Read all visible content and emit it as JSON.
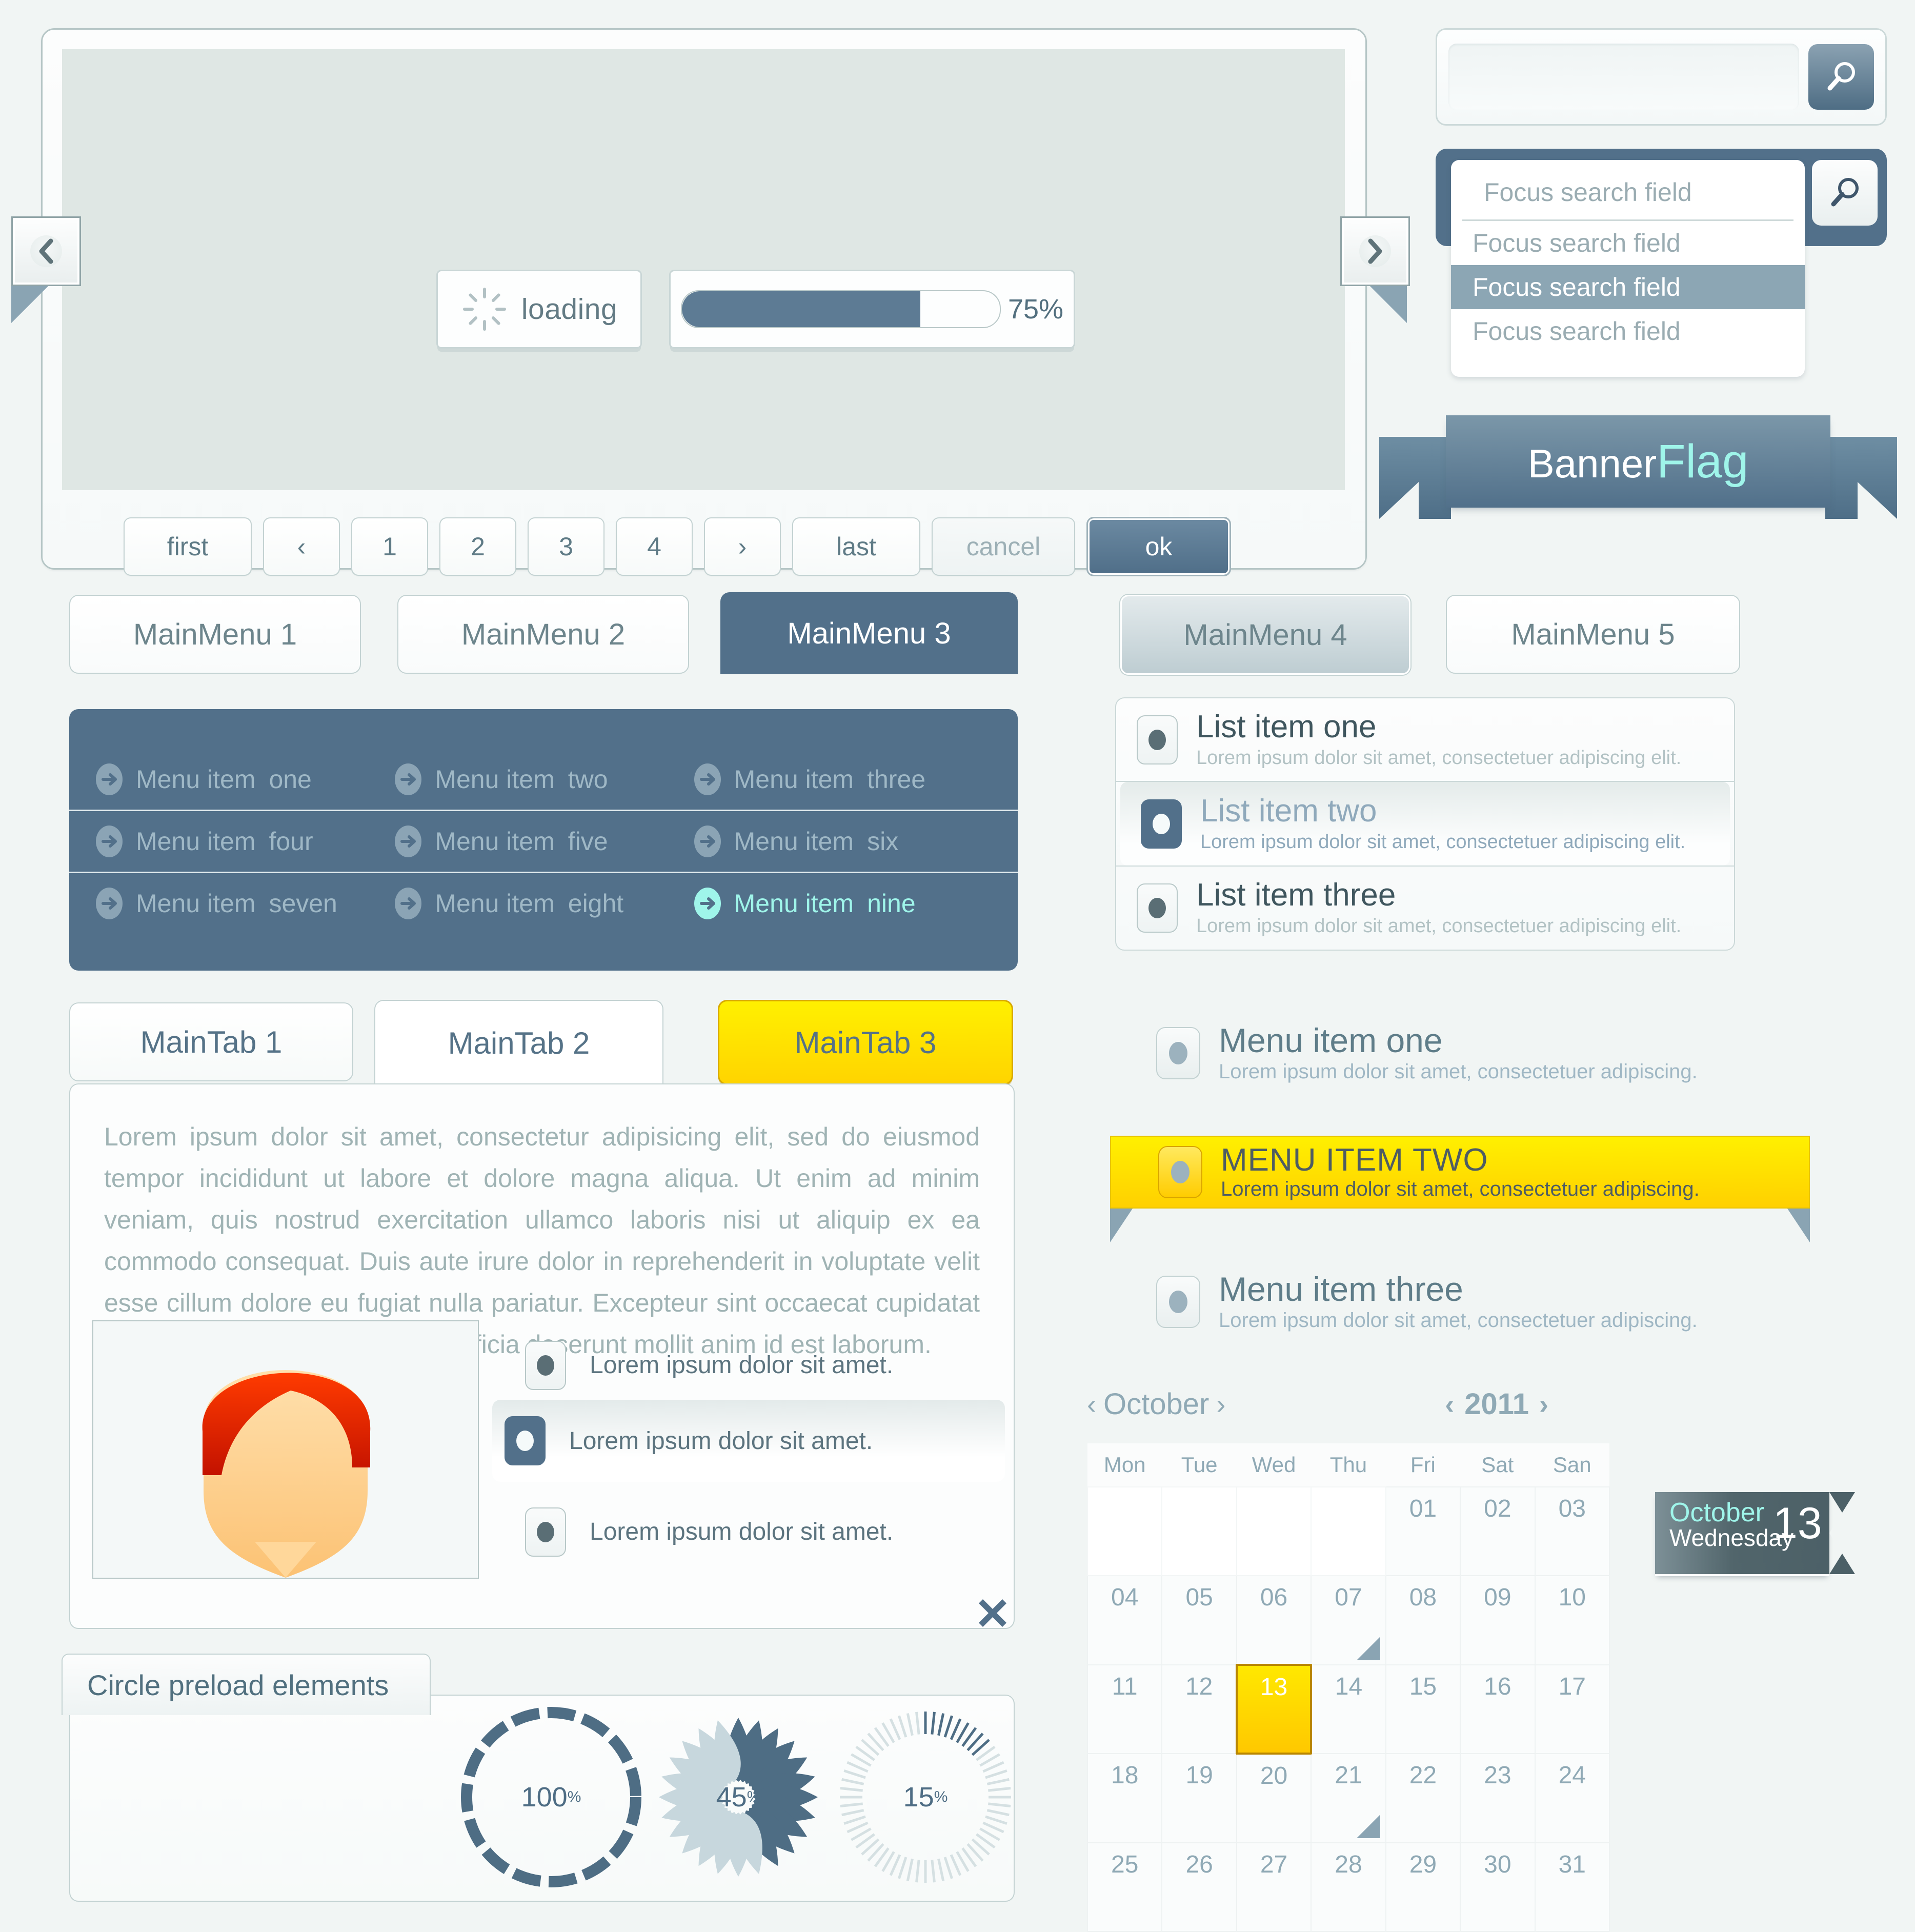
{
  "carousel": {
    "prev_icon": "chevron-left-icon",
    "next_icon": "chevron-right-icon",
    "loading_label": "loading",
    "progress_percent": "75%",
    "progress_value": 75
  },
  "pagination": {
    "first": "first",
    "prev": "‹",
    "pages": [
      "1",
      "2",
      "3",
      "4"
    ],
    "next": "›",
    "last": "last",
    "cancel": "cancel",
    "ok": "ok"
  },
  "search": {
    "plain_value": "",
    "plain_placeholder": "",
    "icon": "magnifier-icon",
    "focus_value": "Focus search field",
    "options": [
      "Focus search field",
      "Focus search field",
      "Focus search field"
    ],
    "selected_index": 1
  },
  "banner": {
    "text_main": "Banner",
    "text_accent": "Flag"
  },
  "main_menu": {
    "tabs": [
      {
        "label": "MainMenu 1",
        "state": "normal"
      },
      {
        "label": "MainMenu 2",
        "state": "normal"
      },
      {
        "label": "MainMenu 3",
        "state": "active"
      },
      {
        "label": "MainMenu 4",
        "state": "pressed"
      },
      {
        "label": "MainMenu 5",
        "state": "normal"
      }
    ],
    "panel_items": [
      {
        "label": "Menu item",
        "suffix": "one",
        "active": false
      },
      {
        "label": "Menu item",
        "suffix": "two",
        "active": false
      },
      {
        "label": "Menu item",
        "suffix": "three",
        "active": false
      },
      {
        "label": "Menu item",
        "suffix": "four",
        "active": false
      },
      {
        "label": "Menu item",
        "suffix": "five",
        "active": false
      },
      {
        "label": "Menu item",
        "suffix": "six",
        "active": false
      },
      {
        "label": "Menu item",
        "suffix": "seven",
        "active": false
      },
      {
        "label": "Menu item",
        "suffix": "eight",
        "active": false
      },
      {
        "label": "Menu item",
        "suffix": "nine",
        "active": true
      }
    ]
  },
  "list_panel": {
    "items": [
      {
        "title": "List item one",
        "sub": "Lorem ipsum dolor sit amet, consectetuer adipiscing elit.",
        "selected": false
      },
      {
        "title": "List item two",
        "sub": "Lorem ipsum dolor sit amet, consectetuer adipiscing elit.",
        "selected": true
      },
      {
        "title": "List item three",
        "sub": "Lorem ipsum dolor sit amet, consectetuer adipiscing elit.",
        "selected": false
      }
    ]
  },
  "menu_radio_group": {
    "items": [
      {
        "title": "Menu item one",
        "sub": "Lorem ipsum dolor sit amet, consectetuer adipiscing.",
        "highlight": false
      },
      {
        "title": "MENU ITEM TWO",
        "sub": "Lorem ipsum dolor sit amet, consectetuer adipiscing.",
        "highlight": true
      },
      {
        "title": "Menu item three",
        "sub": "Lorem ipsum dolor sit amet, consectetuer adipiscing.",
        "highlight": false
      }
    ]
  },
  "main_tabs": {
    "tabs": [
      {
        "label": "MainTab 1",
        "state": "normal"
      },
      {
        "label": "MainTab 2",
        "state": "active"
      },
      {
        "label": "MainTab 3",
        "state": "highlight"
      }
    ],
    "body_text": "Lorem ipsum dolor sit amet, consectetur adipisicing elit, sed do eiusmod tempor incididunt ut labore et dolore magna aliqua. Ut enim ad minim veniam, quis nostrud exercitation ullamco laboris nisi ut aliquip ex ea commodo consequat. Duis aute irure dolor in reprehenderit in voluptate velit esse cillum dolore eu fugiat nulla pariatur. Excepteur sint occaecat cupidatat non proident, sunt in culpa qui officia deserunt mollit anim id est laborum.",
    "avatar_alt": "user-avatar",
    "radio_options": [
      {
        "label": "Lorem ipsum dolor sit amet.",
        "selected": false
      },
      {
        "label": "Lorem ipsum dolor sit amet.",
        "selected": true
      },
      {
        "label": "Lorem ipsum dolor sit amet.",
        "selected": false
      }
    ],
    "close_icon": "close-x-icon"
  },
  "circle_preload": {
    "title": "Circle preload elements",
    "rings": [
      {
        "value": "100",
        "unit": "%",
        "percent": 100,
        "style": "dashes"
      },
      {
        "value": "45",
        "unit": "%",
        "percent": 45,
        "style": "petals"
      },
      {
        "value": "15",
        "unit": "%",
        "percent": 15,
        "style": "ticks"
      }
    ]
  },
  "calendar": {
    "month": "October",
    "year": "2011",
    "prev_icon": "chevron-left-icon",
    "next_icon": "chevron-right-icon",
    "weekdays": [
      "Mon",
      "Tue",
      "Wed",
      "Thu",
      "Fri",
      "Sat",
      "San"
    ],
    "weeks": [
      [
        "",
        "",
        "",
        "",
        "01",
        "02",
        "03"
      ],
      [
        "04",
        "05",
        "06",
        "07",
        "08",
        "09",
        "10"
      ],
      [
        "11",
        "12",
        "13",
        "14",
        "15",
        "16",
        "17"
      ],
      [
        "18",
        "19",
        "20",
        "21",
        "22",
        "23",
        "24"
      ],
      [
        "25",
        "26",
        "27",
        "28",
        "29",
        "30",
        "31"
      ]
    ],
    "today": "13",
    "marked_cells": [
      "07",
      "21"
    ]
  },
  "date_ribbon": {
    "month": "October",
    "weekday": "Wednesday",
    "day": "13"
  },
  "colors": {
    "page_bg": "#f1f5f4",
    "accent_blue": "#52708a",
    "accent_cyan": "#9ff5ea",
    "accent_yellow": "#ffd400",
    "muted": "#9fb3b4"
  }
}
